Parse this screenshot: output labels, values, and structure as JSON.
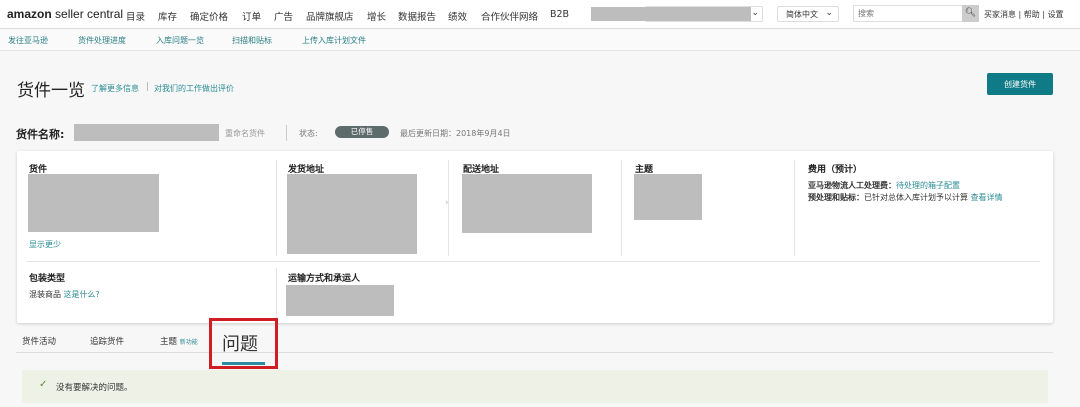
{
  "topnav": {
    "logo_bold": "amazon",
    "logo_rest": " seller central",
    "items": [
      "目录",
      "库存",
      "确定价格",
      "订单",
      "广告",
      "品牌旗舰店",
      "增长",
      "数据报告",
      "绩效",
      "合作伙伴网络",
      "B2B"
    ],
    "language": "简体中文",
    "search_placeholder": "搜索",
    "links": [
      "买家消息",
      "帮助",
      "设置"
    ]
  },
  "subnav": [
    "发往亚马逊",
    "货件处理进度",
    "入库问题一览",
    "扫描和贴标",
    "上传入库计划文件"
  ],
  "header": {
    "title": "货件一览",
    "learn_more": "了解更多信息",
    "feedback": "对我们的工作做出评价",
    "create_button": "创建货件"
  },
  "shipment": {
    "name_label": "货件名称:",
    "rename": "重命名货件",
    "status_label": "状态:",
    "status": "已停售",
    "last_updated": "最后更新日期：2018年9月4日"
  },
  "card": {
    "shipment": "货件",
    "show_less": "显示更少",
    "from": "发货地址",
    "to": "配送地址",
    "theme": "主题",
    "fees": "费用（预计）",
    "fee1_label": "亚马逊物流人工处理费：",
    "fee1_value": "待处理的箱子配置",
    "fee2_label": "预处理和贴标：",
    "fee2_value": "已针对总体入库计划予以计算",
    "fee2_link": "查看详情",
    "packing": "包装类型",
    "packing_value": "混装商品",
    "packing_link": "这是什么?",
    "shipping": "运输方式和承运人"
  },
  "tabs": {
    "activity": "货件活动",
    "track": "追踪货件",
    "theme": "主题",
    "theme_badge": "新功能",
    "issues": "问题"
  },
  "banner": {
    "message": "没有要解决的问题。"
  }
}
